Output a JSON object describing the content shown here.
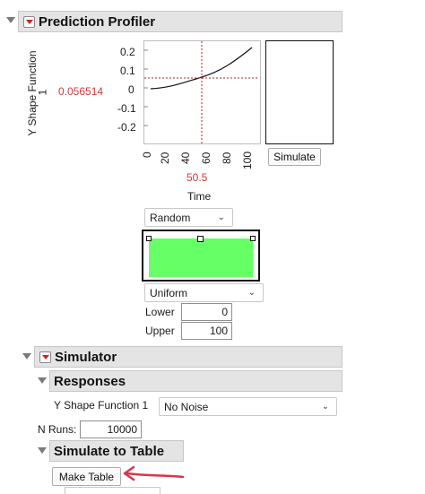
{
  "profiler": {
    "title": "Prediction Profiler",
    "y_label": "Y Shape Function",
    "y_label_sub": "1",
    "y_value": "0.056514",
    "y_ticks": [
      "0.2",
      "0.1",
      "0",
      "-0.1",
      "-0.2"
    ],
    "x_ticks": [
      "0",
      "20",
      "40",
      "60",
      "80",
      "100"
    ],
    "x_value": "50.5",
    "x_label": "Time",
    "simulate_label": "Simulate",
    "random_option": "Random",
    "distribution_option": "Uniform",
    "lower_label": "Lower",
    "lower_value": "0",
    "upper_label": "Upper",
    "upper_value": "100",
    "uniform_color": "#66ff66"
  },
  "simulator": {
    "title": "Simulator",
    "responses_title": "Responses",
    "response_label": "Y Shape Function 1",
    "noise_option": "No Noise",
    "n_runs_label": "N Runs:",
    "n_runs_value": "10000",
    "simulate_table_title": "Simulate to Table",
    "make_table_label": "Make Table"
  }
}
